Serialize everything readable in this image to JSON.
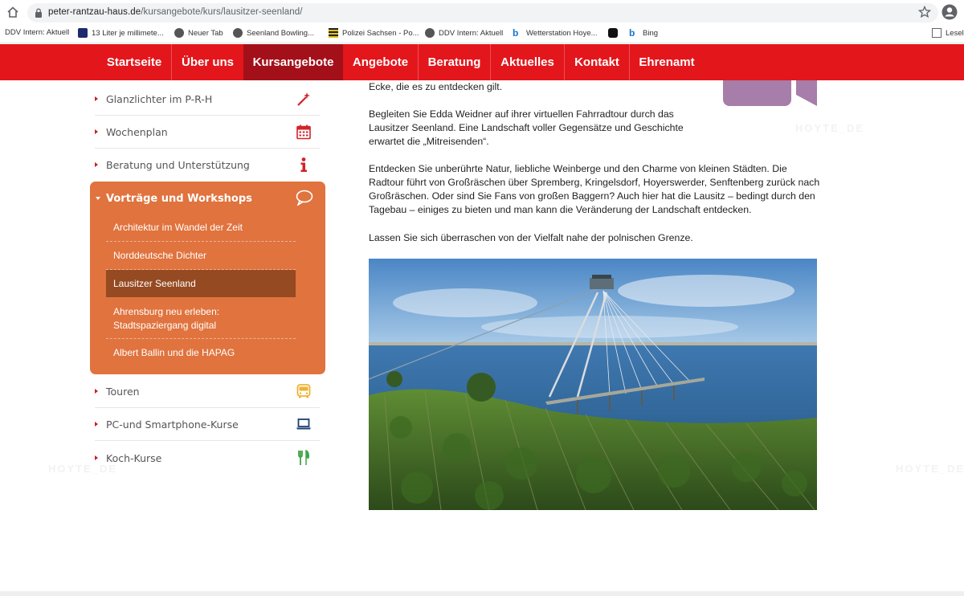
{
  "browser": {
    "url_domain": "peter-rantzau-haus.de",
    "url_path": "/kursangebote/kurs/lausitzer-seenland/",
    "bookmarks": [
      {
        "label": "DDV Intern: Aktuell",
        "icon": "none"
      },
      {
        "label": "13 Liter je millimete...",
        "icon": "blue-square-icon"
      },
      {
        "label": "Neuer Tab",
        "icon": "globe-icon"
      },
      {
        "label": "Seenland Bowling...",
        "icon": "globe-icon"
      },
      {
        "label": "Polizei Sachsen - Po...",
        "icon": "saxony-crest-icon"
      },
      {
        "label": "DDV Intern: Aktuell",
        "icon": "globe-icon"
      },
      {
        "label": "Wetterstation Hoye...",
        "icon": "bing-icon"
      },
      {
        "label": "",
        "icon": "dark-badge-icon"
      },
      {
        "label": "Bing",
        "icon": "bing-icon"
      },
      {
        "label": "Leseli",
        "icon": "reading-list-icon"
      }
    ]
  },
  "nav": {
    "items": [
      "Startseite",
      "Über uns",
      "Kursangebote",
      "Angebote",
      "Beratung",
      "Aktuelles",
      "Kontakt",
      "Ehrenamt"
    ],
    "active": "Kursangebote",
    "color": "#e3161c",
    "active_color": "#a3101a"
  },
  "sidebar": {
    "top_items": [
      {
        "label": "Glanzlichter im P-R-H",
        "icon": "magic-wand-icon"
      },
      {
        "label": "Wochenplan",
        "icon": "calendar-icon"
      },
      {
        "label": "Beratung und Unterstützung",
        "icon": "info-icon"
      }
    ],
    "open_section": {
      "label": "Vorträge und Workshops",
      "icon": "speech-bubble-icon",
      "items": [
        {
          "label": "Architektur im Wandel der Zeit"
        },
        {
          "label": "Norddeutsche Dichter"
        },
        {
          "label": "Lausitzer Seenland",
          "active": true
        },
        {
          "label_line1": "Ahrensburg neu erleben:",
          "label_line2": "Stadtspaziergang digital"
        },
        {
          "label": "Albert Ballin und die HAPAG"
        }
      ],
      "color": "#e0733e"
    },
    "bottom_items": [
      {
        "label": "Touren",
        "icon": "bus-icon"
      },
      {
        "label": "PC-und Smartphone-Kurse",
        "icon": "laptop-icon"
      },
      {
        "label": "Koch-Kurse",
        "icon": "cutlery-icon"
      }
    ]
  },
  "content": {
    "p0": "Ecke, die es zu entdecken gilt.",
    "p1": "Begleiten Sie Edda Weidner auf ihrer virtuellen Fahrradtour durch das Lausitzer Seenland. Eine Landschaft voller Gegensätze und Geschichte erwartet die „Mitreisenden“.",
    "p2": "Entdecken Sie unberührte Natur, liebliche Weinberge und den Charme von kleinen Städten.  Die Radtour führt von Großräschen über Spremberg, Kringelsdorf, Hoyerswerder, Senftenberg zurück nach Großräschen. Oder sind Sie Fans von großen Baggern? Auch hier hat die Lausitz – bedingt durch den Tagebau – einiges zu bieten und man kann die Veränderung der Landschaft entdecken.",
    "p3": "Lassen Sie sich überraschen von der Vielfalt nahe der polnischen Grenze."
  },
  "watermark": "HOYTE_DE"
}
